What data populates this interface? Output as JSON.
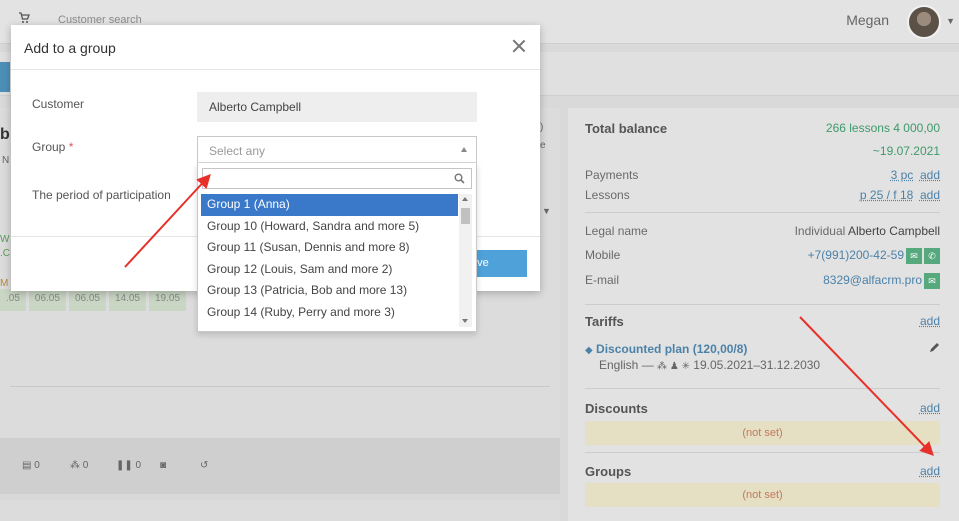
{
  "topbar": {
    "search_label": "Customer search",
    "user_name": "Megan",
    "icons": {
      "cart": "cart-icon",
      "caret": "chevron-down-icon"
    }
  },
  "background": {
    "fragments": {
      "b": "b",
      "n": "N",
      "p": ")",
      "e": "e",
      "w": "W",
      "c": ".C",
      "m": "M"
    },
    "dates": [
      ".05",
      "06.05",
      "06.05",
      "14.05",
      "19.05"
    ],
    "toolbar_counts": [
      "0",
      "0",
      "0"
    ]
  },
  "right_panel": {
    "total_balance_label": "Total balance",
    "total_balance_value": "266 lessons  4 000,00",
    "total_balance_date": "~19.07.2021",
    "payments_label": "Payments",
    "payments_value": "3 pc",
    "lessons_label": "Lessons",
    "lessons_value": "p 25 / f 18",
    "add_label": "add",
    "legal_name_label": "Legal name",
    "legal_name_prefix": "Individual",
    "legal_name_value": "Alberto Campbell",
    "mobile_label": "Mobile",
    "mobile_value": "+7(991)200-42-59",
    "email_label": "E-mail",
    "email_value": "8329@alfacrm.pro",
    "tariffs_title": "Tariffs",
    "tariff_name": "Discounted plan (120,00/8)",
    "tariff_subject": "English —",
    "tariff_dates": "19.05.2021–31.12.2030",
    "discounts_title": "Discounts",
    "discounts_value": "(not set)",
    "groups_title": "Groups",
    "groups_value": "(not set)"
  },
  "modal": {
    "title": "Add to a group",
    "customer_label": "Customer",
    "customer_value": "Alberto Campbell",
    "group_label": "Group",
    "required_mark": "*",
    "group_placeholder": "Select any",
    "period_label": "The period of participation",
    "save_label": "ave"
  },
  "dropdown": {
    "search_value": "",
    "items": [
      "Group 1 (Anna)",
      "Group 10 (Howard, Sandra and more 5)",
      "Group 11 (Susan, Dennis and more 8)",
      "Group 12 (Louis, Sam and more 2)",
      "Group 13 (Patricia, Bob and more 13)",
      "Group 14 (Ruby, Perry and more 3)"
    ],
    "selected_index": 0
  },
  "colors": {
    "accent_blue": "#3a78c9",
    "save_blue": "#4ea2d9",
    "green": "#3e9a6a",
    "link": "#4b82a8",
    "annotation_red": "#e8302a",
    "notset_bg": "#e5dfc4"
  }
}
